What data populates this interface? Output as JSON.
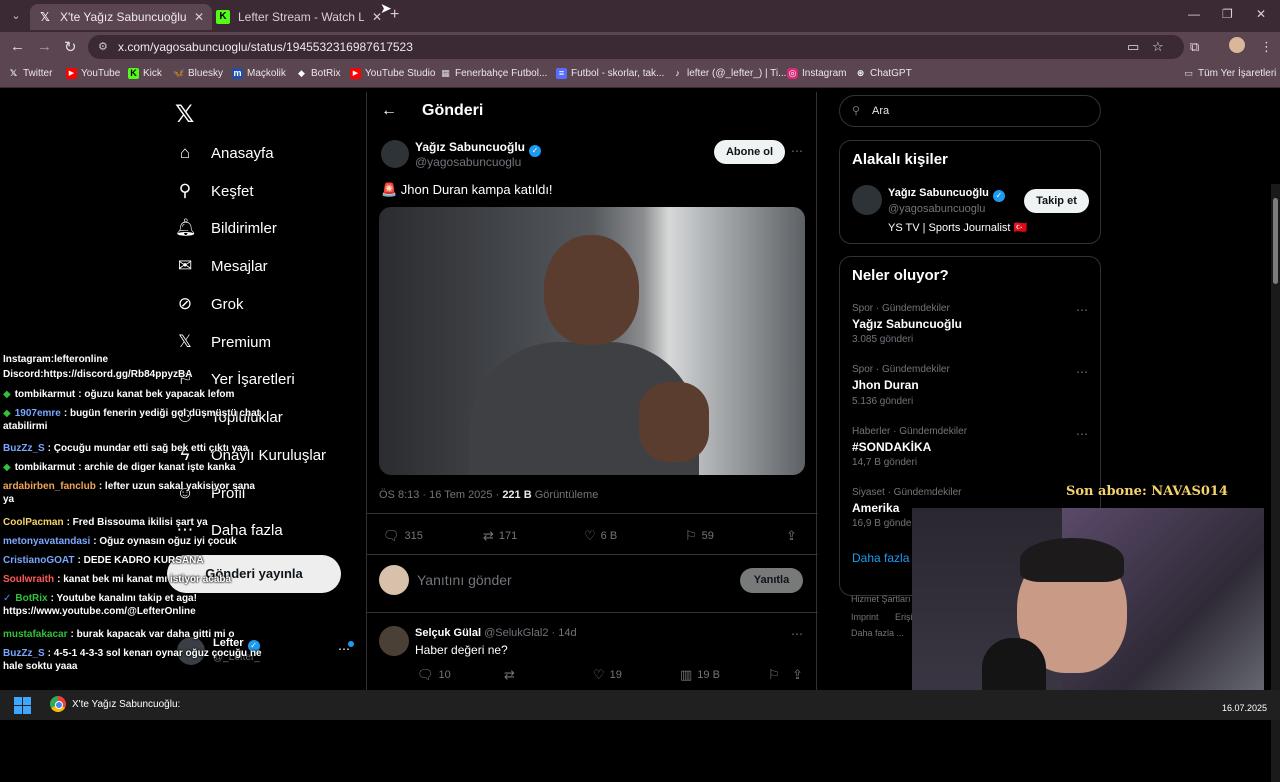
{
  "browser": {
    "tabs": [
      {
        "title": "X'te Yağız Sabuncuoğlu: \"🚨 Jh",
        "icon": "x-icon"
      },
      {
        "title": "Lefter Stream - Watch Live on K",
        "icon": "kick-icon"
      }
    ],
    "url": "x.com/yagosabuncuoglu/status/1945532316987617523",
    "bookmarks": [
      "Twitter",
      "YouTube",
      "Kick",
      "Bluesky",
      "Maçkolik",
      "BotRix",
      "YouTube Studio",
      "Fenerbahçe Futbol...",
      "Futbol - skorlar, tak...",
      "lefter (@_lefter_) | Ti...",
      "Instagram",
      "ChatGPT"
    ],
    "all_bookmarks": "Tüm Yer İşaretleri"
  },
  "sidebar": {
    "items": [
      "Anasayfa",
      "Keşfet",
      "Bildirimler",
      "Mesajlar",
      "Grok",
      "Premium",
      "Yer İşaretleri",
      "Topluluklar",
      "Onaylı Kuruluşlar",
      "Profil",
      "Daha fazla"
    ],
    "post_button": "Gönderi yayınla",
    "account_name": "Lefter",
    "account_handle": "@_Lefter_"
  },
  "main": {
    "header": "Gönderi",
    "author_name": "Yağız Sabuncuoğlu",
    "author_handle": "@yagosabuncuoglu",
    "subscribe": "Abone ol",
    "text": "🚨 Jhon Duran kampa katıldı!",
    "time": "ÖS 8:13 · 16 Tem 2025 · ",
    "views": "221 B",
    "views_label": " Görüntüleme",
    "stats": {
      "replies": "315",
      "reposts": "171",
      "likes": "6 B",
      "bookmarks": "59"
    },
    "reply_placeholder": "Yanıtını gönder",
    "reply_button": "Yanıtla",
    "reply": {
      "name": "Selçuk Gülal",
      "handle": "@SelukGlal2 · 14d",
      "text": "Haber değeri ne?",
      "stats": {
        "replies": "10",
        "likes": "19",
        "views": "19 B"
      }
    }
  },
  "right": {
    "search_placeholder": "Ara",
    "relevant_title": "Alakalı kişiler",
    "person": {
      "name": "Yağız Sabuncuoğlu",
      "handle": "@yagosabuncuoglu",
      "bio": "YS TV | Sports Journalist 🇹🇷",
      "follow": "Takip et"
    },
    "trends_title": "Neler oluyor?",
    "trends": [
      {
        "category": "Spor · Gündemdekiler",
        "name": "Yağız Sabuncuoğlu",
        "count": "3.085 gönderi"
      },
      {
        "category": "Spor · Gündemdekiler",
        "name": "Jhon Duran",
        "count": "5.136 gönderi"
      },
      {
        "category": "Haberler · Gündemdekiler",
        "name": "#SONDAKİKA",
        "count": "14,7 B gönderi"
      },
      {
        "category": "Siyaset · Gündemdekiler",
        "name": "Amerika",
        "count": "16,9 B gönderi"
      }
    ],
    "show_more": "Daha fazla g",
    "footer": [
      "Hizmet Şartları",
      "Imprint",
      "Erişi",
      "Daha fazla ..."
    ]
  },
  "chat": [
    {
      "user": "",
      "text": "Instagram:lefteronline",
      "color": "#ffffff",
      "badge": ""
    },
    {
      "user": "",
      "text": "Discord:https://discord.gg/Rb84ppyzBA",
      "color": "#ffffff",
      "badge": ""
    },
    {
      "user": "tombikarmut",
      "text": ": oğuzu kanat bek yapacak lefom",
      "color": "#ffffff",
      "badge": "◆"
    },
    {
      "user": "1907emre",
      "text": ": bugün fenerin yediği gol düşmüştü chat atabilirmi",
      "color": "#7aa7ff",
      "badge": "◆"
    },
    {
      "user": "BuzZz_S",
      "text": ": Çocuğu mundar etti sağ bek etti çıktı yaa",
      "color": "#7aa7ff",
      "badge": ""
    },
    {
      "user": "tombikarmut",
      "text": ": archie de diger kanat işte kanka",
      "color": "#ffffff",
      "badge": "◆"
    },
    {
      "user": "ardabirben_fanclub",
      "text": ": lefter uzun sakal yakisiyor sana ya",
      "color": "#f0a55a",
      "badge": ""
    },
    {
      "user": "CoolPacman",
      "text": ": Fred Bissouma ikilisi şart ya",
      "color": "#f5d36b",
      "badge": ""
    },
    {
      "user": "metonyavatandasi",
      "text": ": Oğuz oynasın oğuz iyi çocuk",
      "color": "#7aa7ff",
      "badge": ""
    },
    {
      "user": "CristianoGOAT",
      "text": ": DEDE KADRO KURSANA",
      "color": "#7aa7ff",
      "badge": ""
    },
    {
      "user": "Soulwraith",
      "text": ": kanat bek mi kanat mı istiyor acaba",
      "color": "#ff5a5a",
      "badge": ""
    },
    {
      "user": "BotRix",
      "text": ": Youtube kanalını takip et aga! https://www.youtube.com/@LefterOnline",
      "color": "#31c13a",
      "badge": "✓"
    },
    {
      "user": "mustafakacar",
      "text": ": burak kapacak var daha gitti mi o",
      "color": "#31c13a",
      "badge": ""
    },
    {
      "user": "BuzZz_S",
      "text": ": 4-5-1 4-3-3 sol kenarı oynar oğuz çocuğu ne hale soktu yaaa",
      "color": "#7aa7ff",
      "badge": ""
    }
  ],
  "stream_overlay": "Son abone: NAVAS014",
  "taskbar": {
    "app_title": "X'te Yağız Sabuncuoğlu:",
    "date": "16.07.2025"
  }
}
